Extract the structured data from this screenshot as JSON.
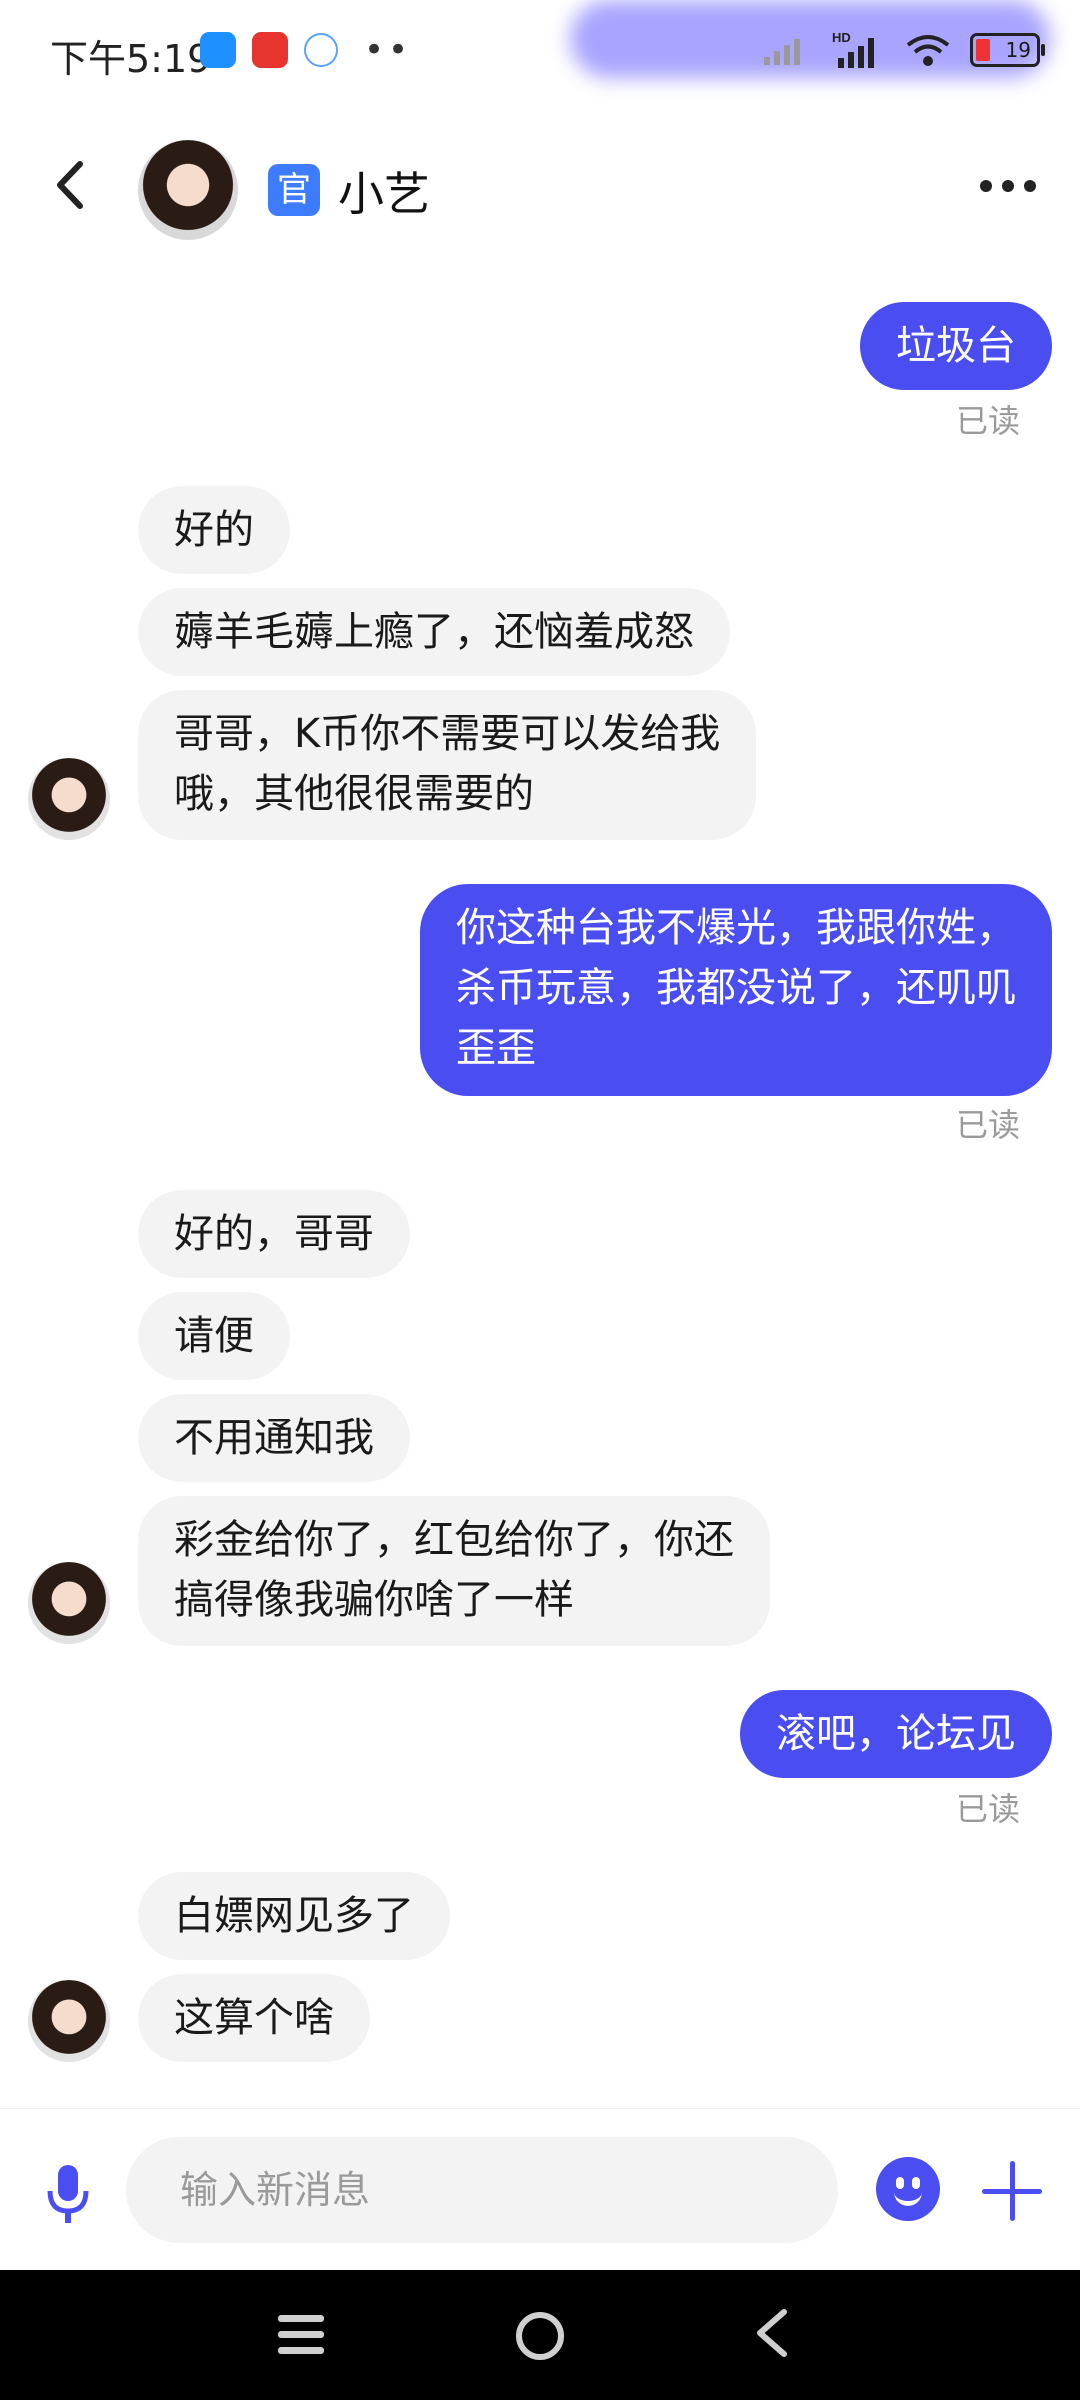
{
  "status_bar": {
    "time": "下午5:19",
    "battery": "19",
    "network": "HD"
  },
  "header": {
    "badge": "官",
    "title": "小艺"
  },
  "messages": [
    {
      "id": 1,
      "dir": "out",
      "lines": [
        "垃圾台"
      ],
      "status": "已读"
    },
    {
      "id": 2,
      "dir": "in",
      "lines": [
        "好的"
      ]
    },
    {
      "id": 3,
      "dir": "in",
      "lines": [
        "薅羊毛薅上瘾了，还恼羞成怒"
      ]
    },
    {
      "id": 4,
      "dir": "in",
      "lines": [
        "哥哥，K币你不需要可以发给我",
        "哦，其他很很需要的"
      ]
    },
    {
      "id": 5,
      "dir": "out",
      "lines": [
        "你这种台我不爆光，我跟你姓，",
        "杀币玩意，我都没说了，还叽叽",
        "歪歪"
      ],
      "status": "已读"
    },
    {
      "id": 6,
      "dir": "in",
      "lines": [
        "好的，哥哥"
      ]
    },
    {
      "id": 7,
      "dir": "in",
      "lines": [
        "请便"
      ]
    },
    {
      "id": 8,
      "dir": "in",
      "lines": [
        "不用通知我"
      ]
    },
    {
      "id": 9,
      "dir": "in",
      "lines": [
        "彩金给你了，红包给你了，你还",
        "搞得像我骗你啥了一样"
      ]
    },
    {
      "id": 10,
      "dir": "out",
      "lines": [
        "滚吧，论坛见"
      ],
      "status": "已读"
    },
    {
      "id": 11,
      "dir": "in",
      "lines": [
        "白嫖网见多了"
      ]
    },
    {
      "id": 12,
      "dir": "in",
      "lines": [
        "这算个啥"
      ]
    }
  ],
  "input": {
    "placeholder": "输入新消息"
  }
}
